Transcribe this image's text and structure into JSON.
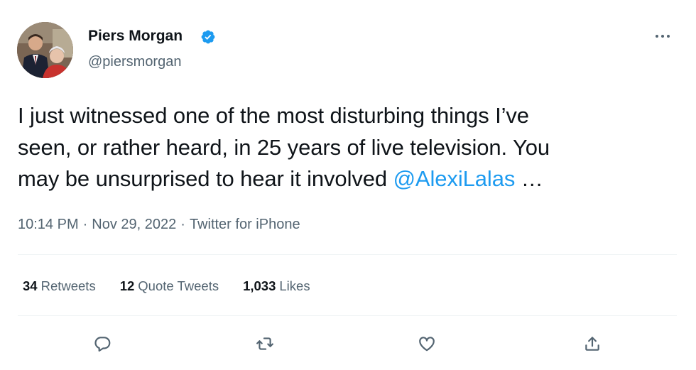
{
  "author": {
    "display_name": "Piers Morgan",
    "handle": "@piersmorgan",
    "verified": true
  },
  "tweet": {
    "line1": "I just witnessed one of the most disturbing things I’ve",
    "line2": "seen, or rather heard, in 25 years of live television. You",
    "line3_prefix": "may be unsurprised to hear it involved ",
    "mention": "@AlexiLalas",
    "line3_suffix": " …"
  },
  "meta": {
    "time": "10:14 PM",
    "separator": "·",
    "date": "Nov 29, 2022",
    "source": "Twitter for iPhone"
  },
  "stats": {
    "retweets_count": "34",
    "retweets_label": "Retweets",
    "quote_count": "12",
    "quote_label": "Quote Tweets",
    "likes_count": "1,033",
    "likes_label": "Likes"
  },
  "icons": {
    "verified": "verified-badge-icon",
    "more": "more-options-icon",
    "reply": "reply-icon",
    "retweet": "retweet-icon",
    "like": "heart-icon",
    "share": "share-icon"
  },
  "colors": {
    "accent": "#1d9bf0",
    "secondary_text": "#536471",
    "primary_text": "#0f1419",
    "divider": "#eff3f4"
  }
}
